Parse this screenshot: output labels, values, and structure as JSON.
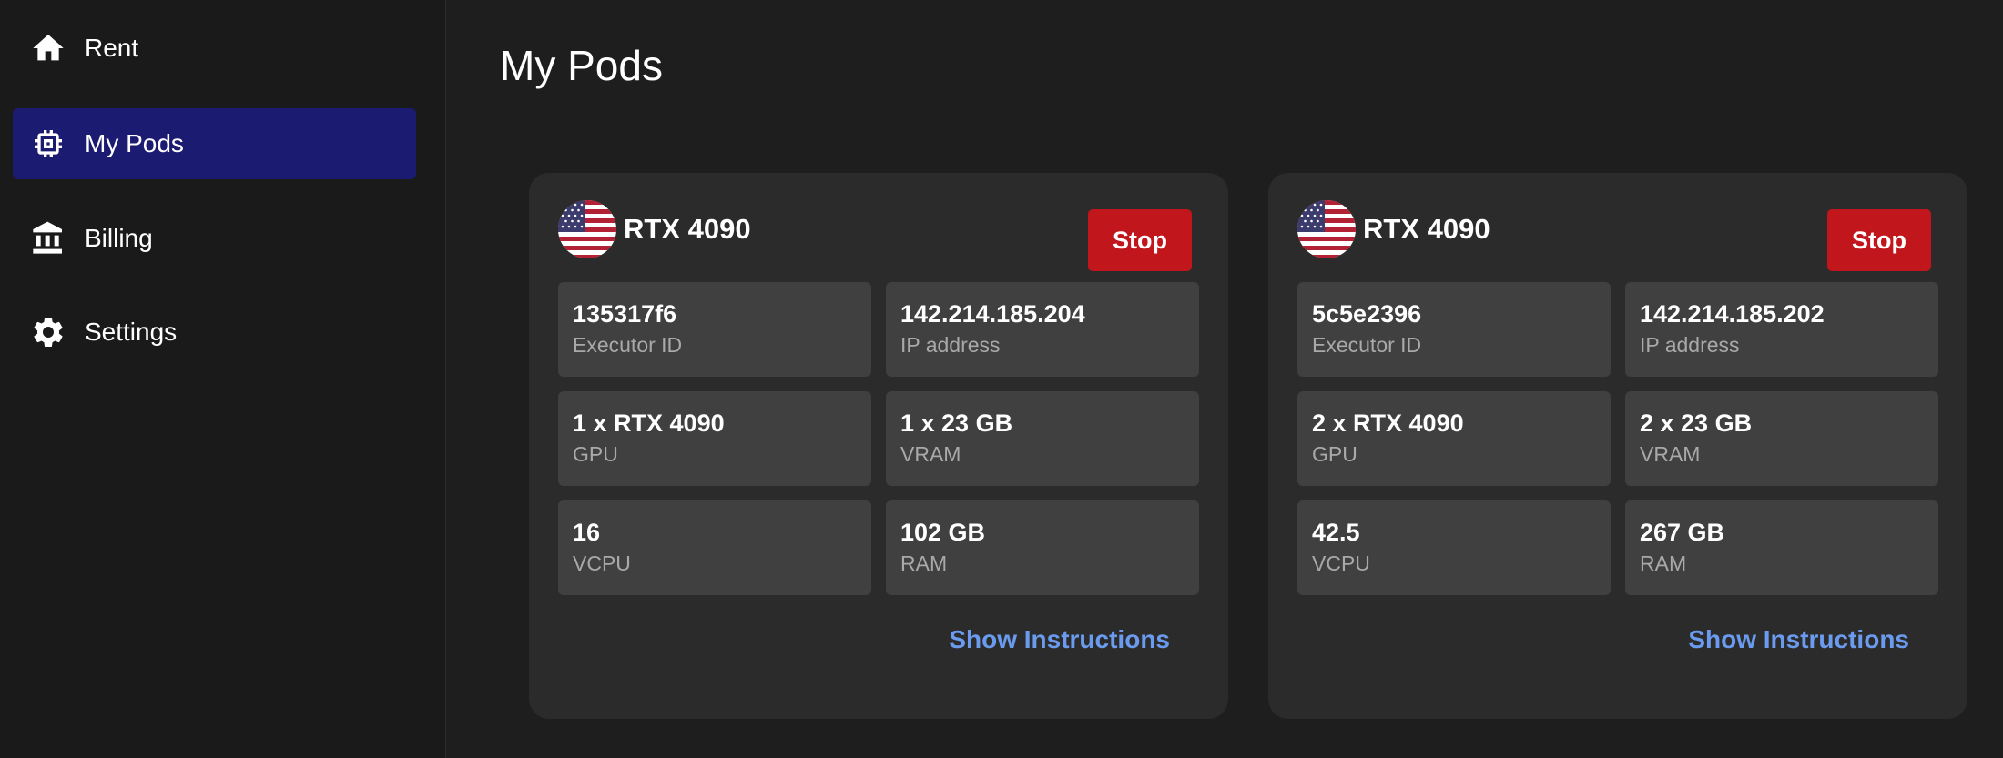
{
  "sidebar": {
    "items": [
      {
        "label": "Rent",
        "icon": "home-icon",
        "active": false
      },
      {
        "label": "My Pods",
        "icon": "chip-icon",
        "active": true
      },
      {
        "label": "Billing",
        "icon": "bank-icon",
        "active": false
      },
      {
        "label": "Settings",
        "icon": "gear-icon",
        "active": false
      }
    ]
  },
  "main": {
    "title": "My Pods",
    "pods": [
      {
        "flag": "us-flag-icon",
        "gpu_name": "RTX 4090",
        "stop_label": "Stop",
        "executor_id": {
          "value": "135317f6",
          "label": "Executor ID"
        },
        "ip": {
          "value": "142.214.185.204",
          "label": "IP address"
        },
        "gpu": {
          "value": "1 x RTX 4090",
          "label": "GPU"
        },
        "vram": {
          "value": "1 x 23 GB",
          "label": "VRAM"
        },
        "vcpu": {
          "value": "16",
          "label": "VCPU"
        },
        "ram": {
          "value": "102 GB",
          "label": "RAM"
        },
        "instructions_label": "Show Instructions"
      },
      {
        "flag": "us-flag-icon",
        "gpu_name": "RTX 4090",
        "stop_label": "Stop",
        "executor_id": {
          "value": "5c5e2396",
          "label": "Executor ID"
        },
        "ip": {
          "value": "142.214.185.202",
          "label": "IP address"
        },
        "gpu": {
          "value": "2 x RTX 4090",
          "label": "GPU"
        },
        "vram": {
          "value": "2 x 23 GB",
          "label": "VRAM"
        },
        "vcpu": {
          "value": "42.5",
          "label": "VCPU"
        },
        "ram": {
          "value": "267 GB",
          "label": "RAM"
        },
        "instructions_label": "Show Instructions"
      }
    ]
  },
  "colors": {
    "background": "#1e1e1e",
    "sidebar_active": "#1c1b72",
    "card": "#2b2b2b",
    "cell": "#404040",
    "stop_button": "#c0161c",
    "link": "#6a9bef"
  }
}
